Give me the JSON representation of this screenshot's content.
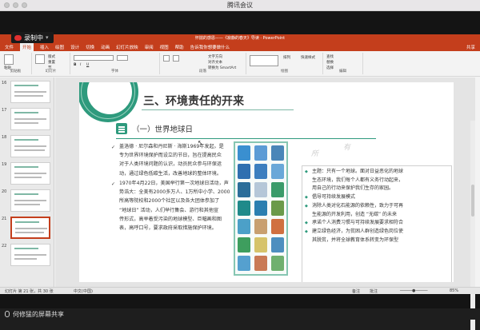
{
  "window_title": "腾讯会议",
  "recording": {
    "label": "录制中"
  },
  "ppt": {
    "title": "怀揣的感恩——《寂静的春天》导读 · PowerPoint",
    "tabs": [
      "文件",
      "开始",
      "插入",
      "绘图",
      "设计",
      "切换",
      "动画",
      "幻灯片放映",
      "审阅",
      "视图",
      "帮助",
      "告诉我你想要做什么"
    ],
    "share_label": "共享",
    "ribbon_groups": [
      "剪贴板",
      "幻灯片",
      "字体",
      "段落",
      "绘图",
      "编辑"
    ],
    "ribbon_items": {
      "paste": "粘贴",
      "new_slide": "新建幻灯片",
      "layout": "版式",
      "reset": "重置",
      "section": "节",
      "shapes": "形状",
      "arrange": "排列",
      "quick_styles": "快速样式",
      "find": "查找",
      "replace": "替换",
      "select": "选择",
      "text_direction": "文字方向",
      "align_text": "对齐文本",
      "smartart": "转换为 SmartArt"
    }
  },
  "thumbnails": [
    {
      "num": "16",
      "selected": false
    },
    {
      "num": "17",
      "selected": false
    },
    {
      "num": "18",
      "selected": false
    },
    {
      "num": "19",
      "selected": false
    },
    {
      "num": "20",
      "selected": false
    },
    {
      "num": "21",
      "selected": true
    },
    {
      "num": "22",
      "selected": false
    }
  ],
  "slide": {
    "title": "三、环境责任的开来",
    "subtitle": "（一）世界地球日",
    "left_paras": [
      "盖洛德 · 尼尔森和丹尼斯 · 海斯1969年发起，是",
      "专为世界环境保护而设立的节日，旨在提高民众",
      "对于人类环境问题的认识，动员民众参与环保运",
      "动，通过绿色低碳生活，改善地球的整体环境。",
      "1970年4月22日，美国举行第一次地球日活动，声",
      "势浩大：全美有2000多万人、1万所中小学、2000",
      "所高等院校和2000个社区以及各大团体参加了",
      "“地球日” 活动，人们举行集会、游行和其他宣",
      "传形式，高举着受污染的地球模型、巨幅画和图",
      "表，高呼口号，要求政府采取措施保护环境。"
    ],
    "right_paras": [
      "主题：只有一个地球。面对日益恶化的地球",
      "生态环境，我们每个人都有义务行动起来，",
      "用自己的行动来保护我们生存的家园。",
      "倡导可持续发展模式",
      "消除人类对化石能源的依赖性，致力于可再",
      "生能源的开发利用，创造 “无碳” 的未来",
      "承诺个人消费习惯与可持续发展要求相符合",
      "建立绿色经济，为贫困人群创造绿色岗位使",
      "其脱贫，并将全球教育体系转变为环保型"
    ],
    "watermarks": [
      "所",
      "有"
    ]
  },
  "status_bar": {
    "slide_info": "幻灯片 第 21 张，共 30 张",
    "language": "中文(中国)",
    "notes": "备注",
    "comments": "批注",
    "zoom": "85%"
  },
  "bottom_bar": {
    "label": "何修猛的屏幕共享"
  },
  "colors": {
    "accent": "#2e9a7d",
    "ppt_brand": "#c43e1c"
  }
}
